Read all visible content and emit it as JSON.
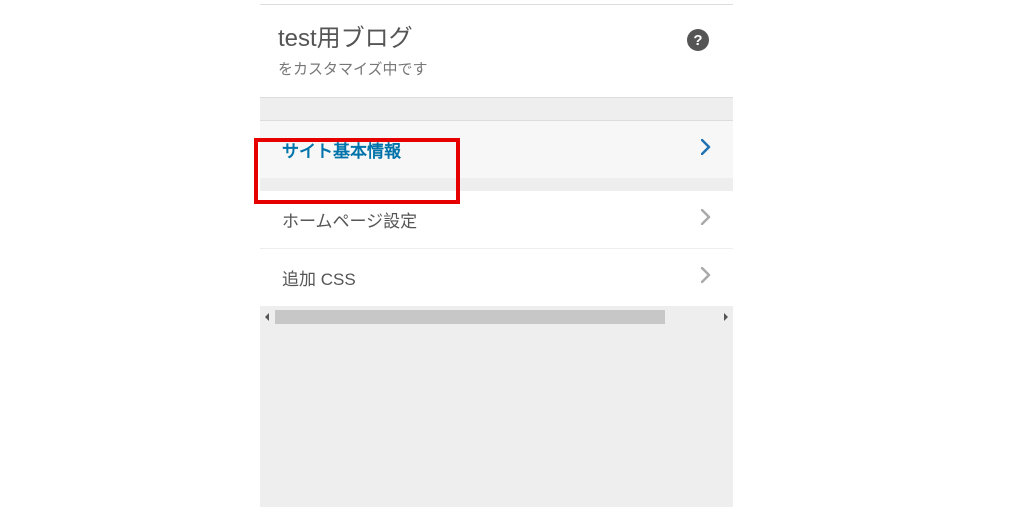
{
  "header": {
    "site_title": "test用ブログ",
    "subtitle": "をカスタマイズ中です",
    "help_glyph": "?"
  },
  "menu": {
    "items": [
      {
        "label": "サイト基本情報",
        "active": true
      },
      {
        "label": "ホームページ設定",
        "active": false
      },
      {
        "label": "追加 CSS",
        "active": false
      }
    ]
  }
}
